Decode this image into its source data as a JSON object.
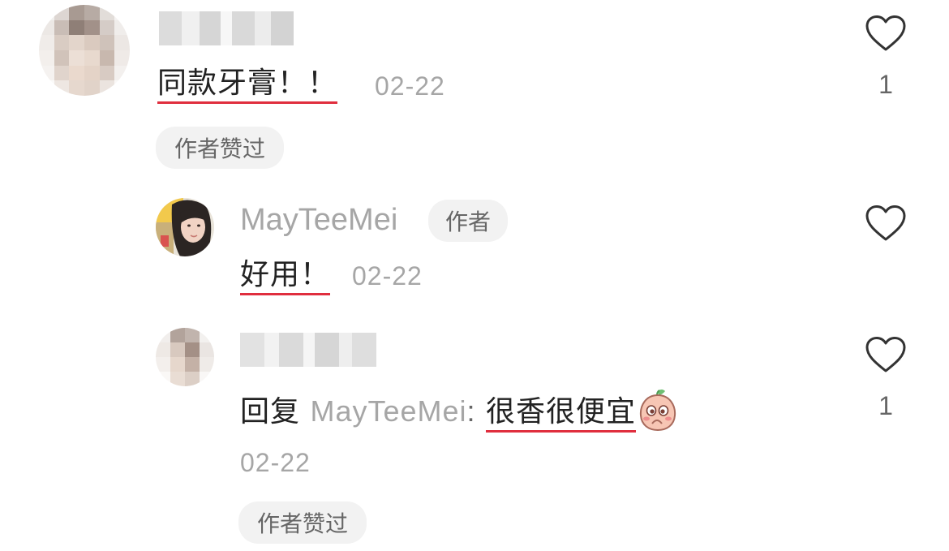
{
  "comments": [
    {
      "text": "同款牙膏！！",
      "date": "02-22",
      "badge": "作者赞过",
      "like_icon": "heart-outline-icon",
      "like_count": "1"
    }
  ],
  "replies": [
    {
      "username": "MayTeeMei",
      "author_tag": "作者",
      "text": "好用！",
      "date": "02-22",
      "like_icon": "heart-outline-icon",
      "like_count": ""
    },
    {
      "reply_prefix": "回复",
      "reply_to": "MayTeeMei",
      "reply_colon": ":",
      "text": "很香很便宜",
      "emoji": "peach-blush-emoji",
      "date": "02-22",
      "badge": "作者赞过",
      "like_icon": "heart-outline-icon",
      "like_count": "1"
    }
  ],
  "colors": {
    "underline": "#e02e3e",
    "muted_text": "#a6a6a6",
    "chip_bg": "#f2f2f2"
  }
}
